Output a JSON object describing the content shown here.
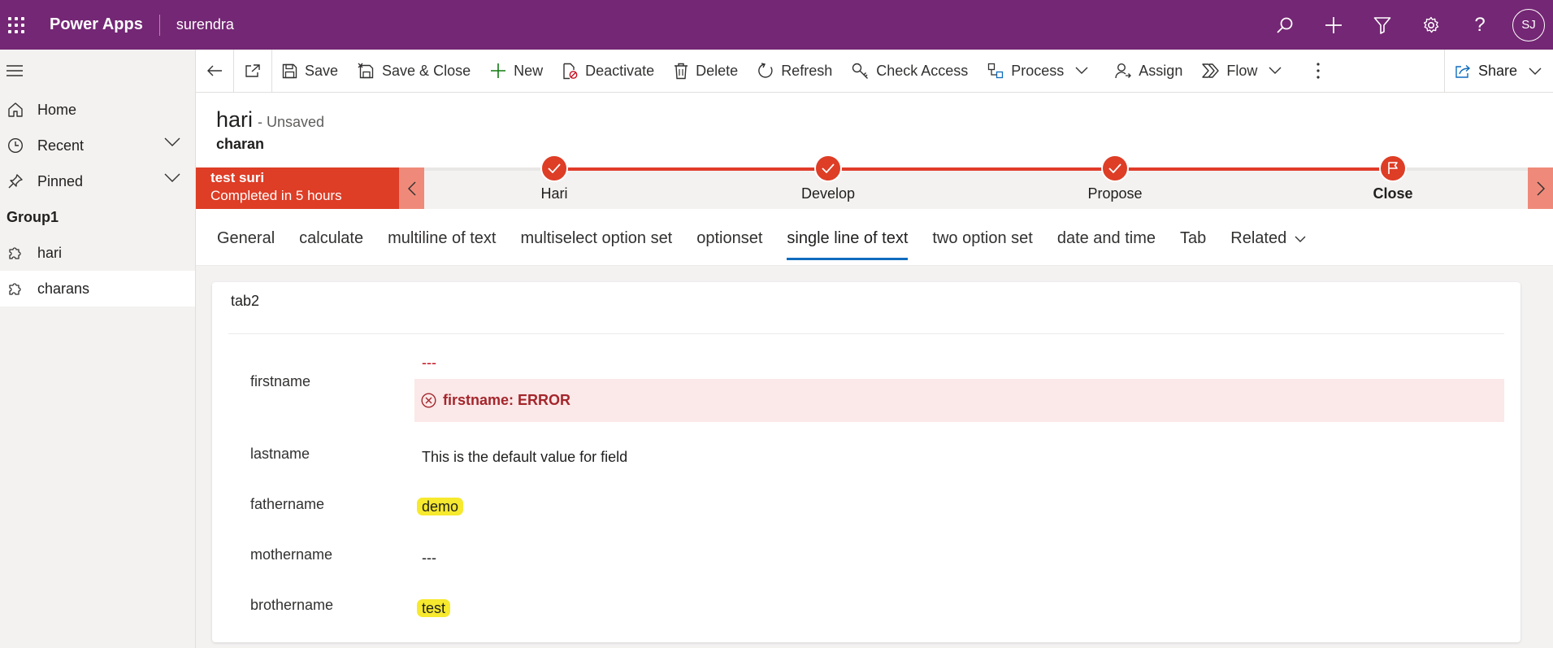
{
  "header": {
    "app_name": "Power Apps",
    "environment": "surendra",
    "user_initials": "SJ"
  },
  "sidebar": {
    "items": [
      {
        "label": "Home",
        "icon": "home-icon"
      },
      {
        "label": "Recent",
        "icon": "clock-icon"
      },
      {
        "label": "Pinned",
        "icon": "pin-icon"
      }
    ],
    "group_label": "Group1",
    "group_items": [
      {
        "label": "hari",
        "icon": "puzzle-icon"
      },
      {
        "label": "charans",
        "icon": "puzzle-icon"
      }
    ],
    "active_item": "charans"
  },
  "commandbar": {
    "save": "Save",
    "save_close": "Save & Close",
    "new": "New",
    "deactivate": "Deactivate",
    "delete": "Delete",
    "refresh": "Refresh",
    "check_access": "Check Access",
    "process": "Process",
    "assign": "Assign",
    "flow": "Flow",
    "share": "Share"
  },
  "record": {
    "title": "hari",
    "status": "- Unsaved",
    "entity": "charan"
  },
  "bpf": {
    "active_name": "test suri",
    "active_sub": "Completed in 5 hours",
    "stages": [
      "Hari",
      "Develop",
      "Propose",
      "Close"
    ],
    "current_stage": "Close",
    "accent_color": "#de3d26"
  },
  "tabs": {
    "items": [
      "General",
      "calculate",
      "multiline of text",
      "multiselect option set",
      "optionset",
      "single line of text",
      "two option set",
      "date and time",
      "Tab",
      "Related"
    ],
    "selected": "single line of text"
  },
  "section": {
    "title": "tab2",
    "fields": [
      {
        "label": "firstname",
        "value": "---"
      },
      {
        "label": "lastname",
        "value": "This is the default value for field"
      },
      {
        "label": "fathername",
        "value": "demo"
      },
      {
        "label": "mothername",
        "value": "---"
      },
      {
        "label": "brothername",
        "value": "test"
      }
    ],
    "error_message": "firstname: ERROR",
    "highlight_color": "#f6e92e"
  }
}
